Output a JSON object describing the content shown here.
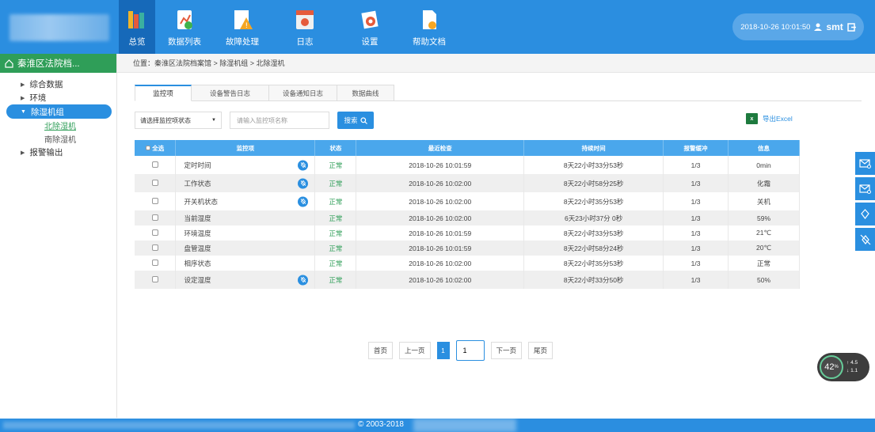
{
  "nav": [
    {
      "label": "总览",
      "icon": "books-icon"
    },
    {
      "label": "数据列表",
      "icon": "chart-doc-icon"
    },
    {
      "label": "故障处理",
      "icon": "warning-icon"
    },
    {
      "label": "日志",
      "icon": "calendar-icon"
    },
    {
      "label": "设置",
      "icon": "gear-icon"
    },
    {
      "label": "帮助文档",
      "icon": "help-doc-icon"
    }
  ],
  "header": {
    "datetime": "2018-10-26 10:01:50",
    "user": "smt"
  },
  "sidebar": {
    "title": "秦淮区法院档...",
    "items": [
      "综合数据",
      "环境",
      "除湿机组",
      "报警输出"
    ],
    "subitems": [
      "北除湿机",
      "南除湿机"
    ]
  },
  "breadcrumb": "位置：秦淮区法院档案馆 > 除湿机组 > 北除湿机",
  "tabs": [
    "监控项",
    "设备警告日志",
    "设备通知日志",
    "数据曲线"
  ],
  "toolbar": {
    "select": "请选择监控项状态",
    "input_placeholder": "请输入监控项名称",
    "search": "搜索",
    "excel": "导出Excel",
    "excel_icon_text": "x"
  },
  "table": {
    "headers": [
      "全选",
      "监控项",
      "状态",
      "最近检查",
      "持续时间",
      "报警缓冲",
      "信息"
    ],
    "rows": [
      {
        "name": "定时时间",
        "status": "正常",
        "last": "2018-10-26 10:01:59",
        "duration": "8天22小时33分53秒",
        "buffer": "1/3",
        "info": "0min",
        "bell": true
      },
      {
        "name": "工作状态",
        "status": "正常",
        "last": "2018-10-26 10:02:00",
        "duration": "8天22小时58分25秒",
        "buffer": "1/3",
        "info": "化霜",
        "bell": true
      },
      {
        "name": "开关机状态",
        "status": "正常",
        "last": "2018-10-26 10:02:00",
        "duration": "8天22小时35分53秒",
        "buffer": "1/3",
        "info": "关机",
        "bell": true
      },
      {
        "name": "当前湿度",
        "status": "正常",
        "last": "2018-10-26 10:02:00",
        "duration": "6天23小时37分 0秒",
        "buffer": "1/3",
        "info": "59%",
        "bell": false
      },
      {
        "name": "环境温度",
        "status": "正常",
        "last": "2018-10-26 10:01:59",
        "duration": "8天22小时33分53秒",
        "buffer": "1/3",
        "info": "21℃",
        "bell": false
      },
      {
        "name": "盘管温度",
        "status": "正常",
        "last": "2018-10-26 10:01:59",
        "duration": "8天22小时58分24秒",
        "buffer": "1/3",
        "info": "20℃",
        "bell": false
      },
      {
        "name": "相序状态",
        "status": "正常",
        "last": "2018-10-26 10:02:00",
        "duration": "8天22小时35分53秒",
        "buffer": "1/3",
        "info": "正常",
        "bell": false
      },
      {
        "name": "设定湿度",
        "status": "正常",
        "last": "2018-10-26 10:02:00",
        "duration": "8天22小时33分50秒",
        "buffer": "1/3",
        "info": "50%",
        "bell": true
      }
    ]
  },
  "pager": {
    "first": "首页",
    "prev": "上一页",
    "current": "1",
    "input": "1",
    "next": "下一页",
    "last": "尾页"
  },
  "speed": {
    "percent": "42",
    "percent_unit": "%",
    "up": "4.5",
    "down": "1.1"
  },
  "footer": {
    "copyright": "© 2003-2018"
  },
  "colors": {
    "primary": "#2b8ee0",
    "green": "#2f9e58",
    "table_header": "#4aa7ec"
  }
}
